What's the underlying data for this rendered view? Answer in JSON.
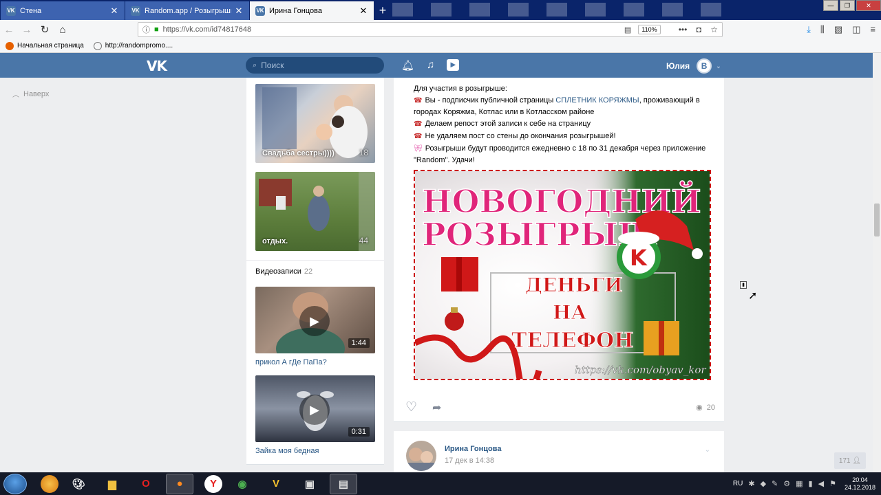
{
  "browser": {
    "tabs": [
      {
        "title": "Стена",
        "icon": "vk-icon",
        "active": false
      },
      {
        "title": "Random.app / Розыгрыши пр",
        "icon": "vk-icon",
        "active": false
      },
      {
        "title": "Ирина Гонцова",
        "icon": "vk-icon",
        "active": true
      }
    ],
    "url": "https://vk.com/id74817648",
    "zoom": "110%",
    "bookmarks": [
      {
        "label": "Начальная страница"
      },
      {
        "label": "http://randompromo...."
      }
    ]
  },
  "vk_header": {
    "search_placeholder": "Поиск",
    "user_name": "Юлия",
    "user_initial": "В"
  },
  "left_nav": {
    "back_to_top": "Наверх"
  },
  "albums": [
    {
      "caption": "Свадьба сестры))))",
      "count": "18"
    },
    {
      "caption": "отдых.",
      "count": "44"
    }
  ],
  "videos": {
    "title": "Видеозаписи",
    "count": "22",
    "items": [
      {
        "name": "прикол А гДе ПаПа?",
        "duration": "1:44"
      },
      {
        "name": "Зайка моя бедная",
        "duration": "0:31"
      }
    ]
  },
  "post": {
    "intro": "Для участия в розыгрыше:",
    "line1_pre": "Вы - подписчик публичной страницы ",
    "line1_link": "СПЛЕТНИК КОРЯЖМЫ",
    "line1_post": ", проживающий в городах Коряжма, Котлас или в Котласском районе",
    "line2": "Делаем репост этой записи к себе на страницу",
    "line3": "Не удаляем пост со стены до окончания розыгрышей!",
    "line4": "Розыгрыши будут проводится ежедневно с 18 по 31 декабря через приложение \"Random\". Удачи!",
    "banner": {
      "title1": "НОВОГОДНИЙ",
      "title2": "РОЗЫГРЫШ",
      "text1": "ДЕНЬГИ",
      "text2": "НА",
      "text3": "ТЕЛЕФОН",
      "url": "https://vk.com/obyav_kor"
    },
    "views": "20"
  },
  "next_post": {
    "author": "Ирина Гонцова",
    "date": "17 дек в 14:38"
  },
  "online_badge": "171",
  "taskbar": {
    "lang": "RU",
    "time": "20:04",
    "date": "24.12.2018"
  },
  "colors": {
    "vk_blue": "#4a76a8",
    "link": "#2a5885",
    "banner_pink": "#e0257a",
    "banner_red": "#cc0000"
  }
}
